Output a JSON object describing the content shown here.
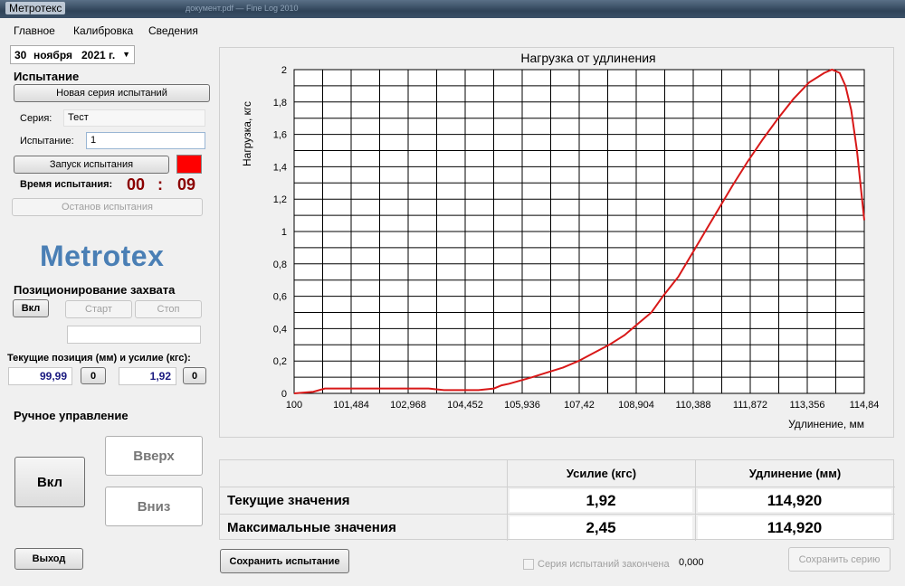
{
  "window": {
    "title": "Метротекс",
    "ghost_text": "документ.pdf — Fine Log 2010"
  },
  "menu": [
    "Главное",
    "Калибровка",
    "Сведения"
  ],
  "date": {
    "day": "30",
    "month": "ноября",
    "year": "2021 г."
  },
  "test": {
    "section_title": "Испытание",
    "new_series_button": "Новая серия испытаний",
    "series_label": "Серия:",
    "series_value": "Тест",
    "test_label": "Испытание:",
    "test_value": "1",
    "start_button": "Запуск испытания",
    "time_label": "Время испытания:",
    "time_min": "00",
    "time_sep": ":",
    "time_sec": "09",
    "stop_button": "Останов испытания",
    "indicator_color": "#ff0000"
  },
  "logo": "Metrotex",
  "positioning": {
    "section_title": "Позиционирование захвата",
    "on_button": "Вкл",
    "start_button": "Старт",
    "stop_button": "Стоп",
    "current_label": "Текущие позиция (мм) и усилие (кгс):",
    "position_value": "99,99",
    "position_zero": "0",
    "force_value": "1,92",
    "force_zero": "0"
  },
  "manual": {
    "section_title": "Ручное управление",
    "on_button": "Вкл",
    "up_button": "Вверх",
    "down_button": "Вниз"
  },
  "exit_button": "Выход",
  "save_test_button": "Сохранить испытание",
  "series_done_checkbox": "Серия испытаний закончена",
  "small_value": "0,000",
  "save_series_button": "Сохранить серию",
  "results": {
    "col_force": "Усилие (кгс)",
    "col_elong": "Удлинение (мм)",
    "row_current": "Текущие значения",
    "row_max": "Максимальные значения",
    "current_force": "1,92",
    "current_elong": "114,920",
    "max_force": "2,45",
    "max_elong": "114,920"
  },
  "chart_data": {
    "type": "line",
    "title": "Нагрузка от удлинения",
    "xlabel": "Удлинение, мм",
    "ylabel": "Нагрузка, кгс",
    "xlim": [
      100,
      114.84
    ],
    "ylim": [
      0,
      2
    ],
    "x_tick_labels": [
      "100",
      "101,484",
      "102,968",
      "104,452",
      "105,936",
      "107,42",
      "108,904",
      "110,388",
      "111,872",
      "113,356",
      "114,84"
    ],
    "y_tick_labels": [
      "0",
      "0,2",
      "0,4",
      "0,6",
      "0,8",
      "1",
      "1,2",
      "1,4",
      "1,6",
      "1,8",
      "2"
    ],
    "grid": true,
    "line_color": "#d81818",
    "series": [
      {
        "x": [
          100,
          100.5,
          100.8,
          101.0,
          101.5,
          102.5,
          103.5,
          103.9,
          104.1,
          104.5,
          104.8,
          105.2,
          105.4,
          105.6,
          105.9,
          106.2,
          106.6,
          107.0,
          107.4,
          107.8,
          108.2,
          108.6,
          108.9,
          109.3,
          109.6,
          110.0,
          110.4,
          110.7,
          111.0,
          111.4,
          111.8,
          112.2,
          112.6,
          113.0,
          113.4,
          113.8,
          114.0,
          114.2,
          114.35,
          114.5,
          114.65,
          114.84
        ],
        "y": [
          0.0,
          0.01,
          0.03,
          0.03,
          0.03,
          0.03,
          0.03,
          0.02,
          0.02,
          0.02,
          0.02,
          0.03,
          0.05,
          0.06,
          0.08,
          0.1,
          0.13,
          0.16,
          0.2,
          0.25,
          0.3,
          0.36,
          0.42,
          0.5,
          0.6,
          0.72,
          0.88,
          1.0,
          1.12,
          1.28,
          1.43,
          1.57,
          1.7,
          1.82,
          1.92,
          1.98,
          2.0,
          1.98,
          1.9,
          1.75,
          1.5,
          1.07
        ]
      }
    ]
  }
}
